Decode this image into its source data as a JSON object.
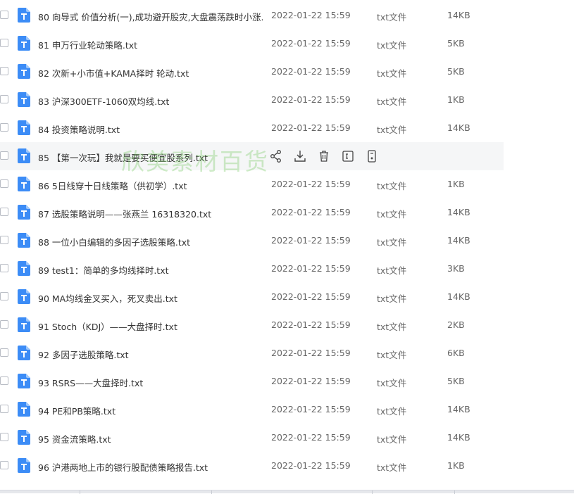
{
  "files": [
    {
      "name": "80 向导式 价值分析(一),成功避开股灾,大盘震荡跌时小涨...",
      "date": "2022-01-22 15:59",
      "type": "txt文件",
      "size": "14KB"
    },
    {
      "name": "81 申万行业轮动策略.txt",
      "date": "2022-01-22 15:59",
      "type": "txt文件",
      "size": "5KB"
    },
    {
      "name": "82 次新+小市值+KAMA择时 轮动.txt",
      "date": "2022-01-22 15:59",
      "type": "txt文件",
      "size": "5KB"
    },
    {
      "name": "83 沪深300ETF-1060双均线.txt",
      "date": "2022-01-22 15:59",
      "type": "txt文件",
      "size": "1KB"
    },
    {
      "name": "84 投资策略说明.txt",
      "date": "2022-01-22 15:59",
      "type": "txt文件",
      "size": "14KB"
    },
    {
      "name": "85 【第一次玩】我就是要买便宜股系列.txt",
      "date": "",
      "type": "",
      "size": ""
    },
    {
      "name": "86 5日线穿十日线策略（供初学）.txt",
      "date": "2022-01-22 15:59",
      "type": "txt文件",
      "size": "1KB"
    },
    {
      "name": "87 选股策略说明——张燕兰 16318320.txt",
      "date": "2022-01-22 15:59",
      "type": "txt文件",
      "size": "14KB"
    },
    {
      "name": "88 一位小白编辑的多因子选股策略.txt",
      "date": "2022-01-22 15:59",
      "type": "txt文件",
      "size": "14KB"
    },
    {
      "name": "89 test1：简单的多均线择时.txt",
      "date": "2022-01-22 15:59",
      "type": "txt文件",
      "size": "3KB"
    },
    {
      "name": "90 MA均线金叉买入，死叉卖出.txt",
      "date": "2022-01-22 15:59",
      "type": "txt文件",
      "size": "14KB"
    },
    {
      "name": "91 Stoch（KDJ）——大盘择时.txt",
      "date": "2022-01-22 15:59",
      "type": "txt文件",
      "size": "2KB"
    },
    {
      "name": "92 多因子选股策略.txt",
      "date": "2022-01-22 15:59",
      "type": "txt文件",
      "size": "6KB"
    },
    {
      "name": "93 RSRS——大盘择时.txt",
      "date": "2022-01-22 15:59",
      "type": "txt文件",
      "size": "5KB"
    },
    {
      "name": "94 PE和PB策略.txt",
      "date": "2022-01-22 15:59",
      "type": "txt文件",
      "size": "14KB"
    },
    {
      "name": "95 资金流策略.txt",
      "date": "2022-01-22 15:59",
      "type": "txt文件",
      "size": "14KB"
    },
    {
      "name": "96 沪港两地上市的银行股配债策略报告.txt",
      "date": "2022-01-22 15:59",
      "type": "txt文件",
      "size": "1KB"
    }
  ],
  "watermark": "欣美素材百货",
  "colors": {
    "icon_blue": "#3c8cf6",
    "hover_row": "#f5f6f7",
    "watermark_green": "#82cd6e"
  },
  "row_actions": [
    "share-icon",
    "download-icon",
    "delete-icon",
    "rename-icon",
    "more-icon"
  ]
}
